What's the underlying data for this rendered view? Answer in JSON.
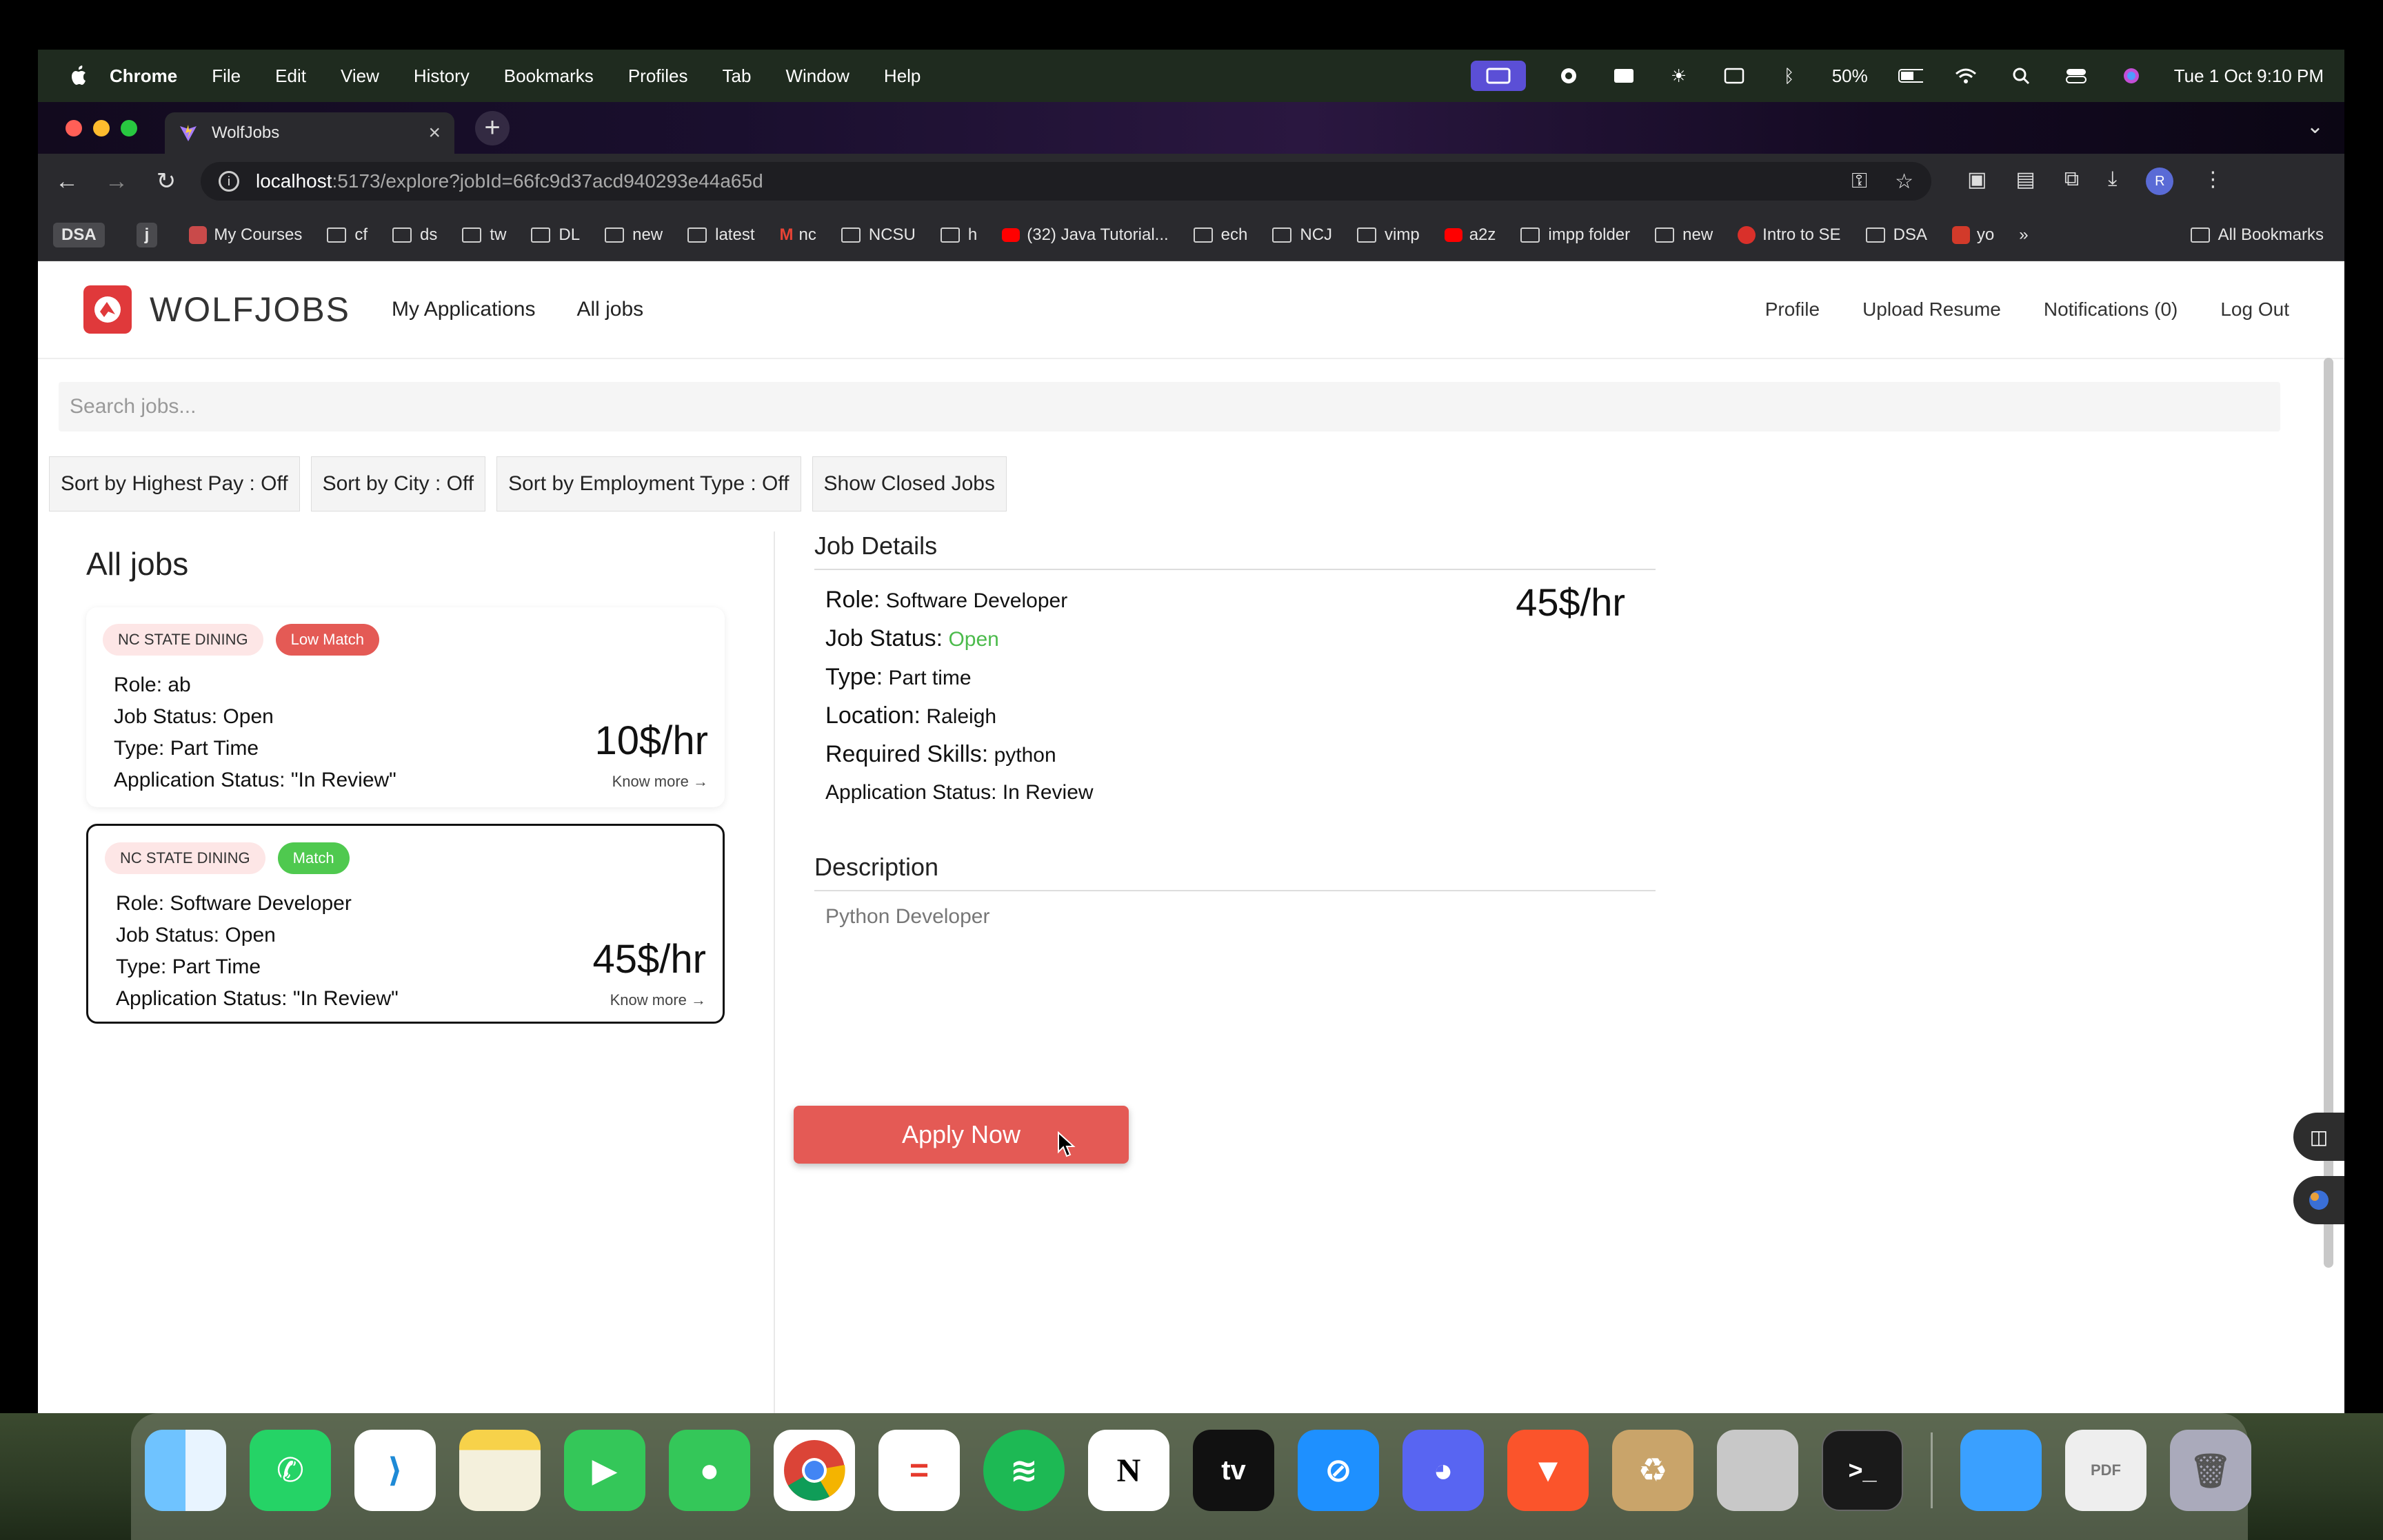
{
  "menubar": {
    "app": "Chrome",
    "items": [
      "File",
      "Edit",
      "View",
      "History",
      "Bookmarks",
      "Profiles",
      "Tab",
      "Window",
      "Help"
    ],
    "battery": "50%",
    "datetime": "Tue 1 Oct  9:10 PM"
  },
  "browser": {
    "tab_title": "WolfJobs",
    "url_host": "localhost",
    "url_path": ":5173/explore?jobId=66fc9d37acd940293e44a65d",
    "avatar_letter": "R",
    "bookmarks": [
      {
        "label": "DSA",
        "type": "chip"
      },
      {
        "label": "j",
        "type": "chip"
      },
      {
        "label": "My Courses",
        "type": "site"
      },
      {
        "label": "cf",
        "type": "folder"
      },
      {
        "label": "ds",
        "type": "folder"
      },
      {
        "label": "tw",
        "type": "folder"
      },
      {
        "label": "DL",
        "type": "folder"
      },
      {
        "label": "new",
        "type": "folder"
      },
      {
        "label": "latest",
        "type": "folder"
      },
      {
        "label": "nc",
        "type": "site"
      },
      {
        "label": "NCSU",
        "type": "folder"
      },
      {
        "label": "h",
        "type": "folder"
      },
      {
        "label": "(32) Java Tutorial...",
        "type": "site"
      },
      {
        "label": "ech",
        "type": "folder"
      },
      {
        "label": "NCJ",
        "type": "folder"
      },
      {
        "label": "vimp",
        "type": "folder"
      },
      {
        "label": "a2z",
        "type": "site"
      },
      {
        "label": "impp folder",
        "type": "folder"
      },
      {
        "label": "new",
        "type": "folder"
      },
      {
        "label": "Intro to SE",
        "type": "site"
      },
      {
        "label": "DSA",
        "type": "folder"
      },
      {
        "label": "yo",
        "type": "site"
      }
    ],
    "more": "»",
    "all_bookmarks": "All Bookmarks"
  },
  "nav": {
    "brand": "WOLFJOBS",
    "links": [
      "My Applications",
      "All jobs"
    ],
    "right": [
      "Profile",
      "Upload Resume",
      "Notifications (0)",
      "Log Out"
    ]
  },
  "search": {
    "placeholder": "Search jobs..."
  },
  "filters": [
    "Sort by Highest Pay : Off",
    "Sort by City : Off",
    "Sort by Employment Type : Off",
    "Show Closed Jobs"
  ],
  "list": {
    "title": "All jobs",
    "jobs": [
      {
        "company": "NC STATE DINING",
        "match": "Low Match",
        "role": "Role: ab",
        "status": "Job Status: Open",
        "type": "Type: Part Time",
        "app_status": "Application Status: \"In Review\"",
        "pay": "10$/hr",
        "more": "Know more →"
      },
      {
        "company": "NC STATE DINING",
        "match": "Match",
        "role": "Role: Software Developer",
        "status": "Job Status: Open",
        "type": "Type: Part Time",
        "app_status": "Application Status: \"In Review\"",
        "pay": "45$/hr",
        "more": "Know more →"
      }
    ]
  },
  "details": {
    "heading": "Job Details",
    "role_label": "Role:",
    "role": "Software Developer",
    "status_label": "Job Status:",
    "status": "Open",
    "type_label": "Type:",
    "type": "Part time",
    "location_label": "Location:",
    "location": "Raleigh",
    "skills_label": "Required Skills:",
    "skills": "python",
    "app_status_label": "Application Status:",
    "app_status": "In Review",
    "pay": "45$/hr",
    "desc_heading": "Description",
    "description": "Python Developer",
    "apply": "Apply Now"
  },
  "colors": {
    "accent": "#e45a55",
    "match_green": "#4fc94f",
    "open_green": "#4cbb4c"
  }
}
